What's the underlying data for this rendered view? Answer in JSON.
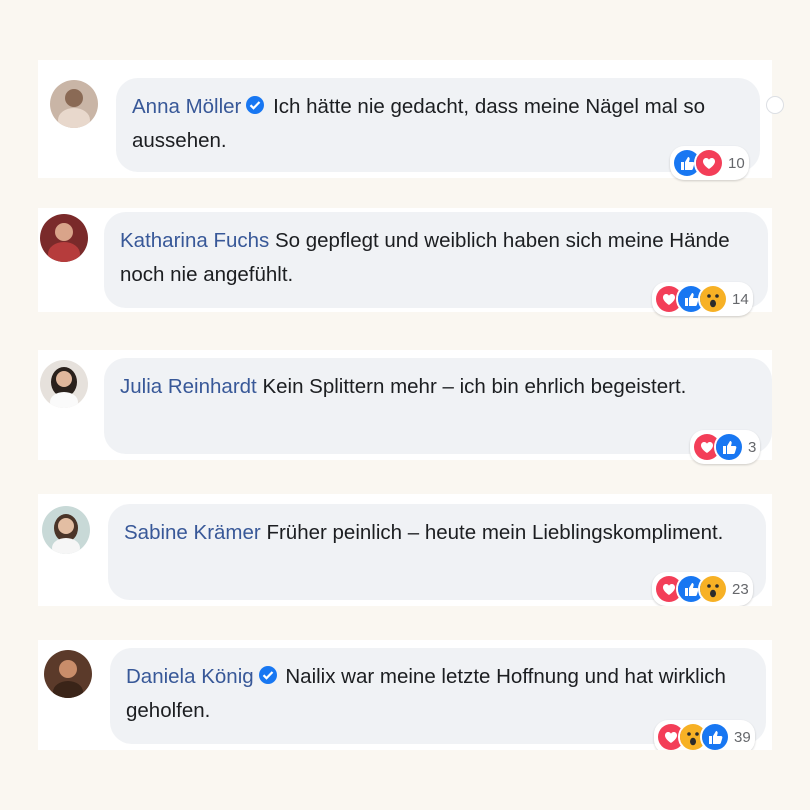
{
  "comments": [
    {
      "name": "Anna Möller",
      "verified": true,
      "text": "Ich hätte nie gedacht, dass meine Nägel mal so aussehen.",
      "reactions": [
        "like-icon",
        "love-icon"
      ],
      "count": "10"
    },
    {
      "name": "Katharina Fuchs",
      "verified": false,
      "text": "So gepflegt und weiblich haben sich meine Hände noch nie angefühlt.",
      "reactions": [
        "love-icon",
        "like-icon",
        "wow-icon"
      ],
      "count": "14"
    },
    {
      "name": "Julia Reinhardt",
      "verified": false,
      "text": "Kein Splittern mehr – ich bin ehrlich begeistert.",
      "reactions": [
        "love-icon",
        "like-icon"
      ],
      "count": "3"
    },
    {
      "name": "Sabine Krämer",
      "verified": false,
      "text": "Früher peinlich – heute mein Lieblingskompliment.",
      "reactions": [
        "love-icon",
        "like-icon",
        "wow-icon"
      ],
      "count": "23"
    },
    {
      "name": "Daniela König",
      "verified": true,
      "text": "Nailix war meine letzte Hoffnung und hat wirklich geholfen.",
      "reactions": [
        "love-icon",
        "wow-icon",
        "like-icon"
      ],
      "count": "39"
    }
  ],
  "colors": {
    "name": "#385898",
    "like": "#1877f2",
    "love": "#f33e58",
    "wow": "#f7b125",
    "bubble": "#f0f2f5"
  }
}
